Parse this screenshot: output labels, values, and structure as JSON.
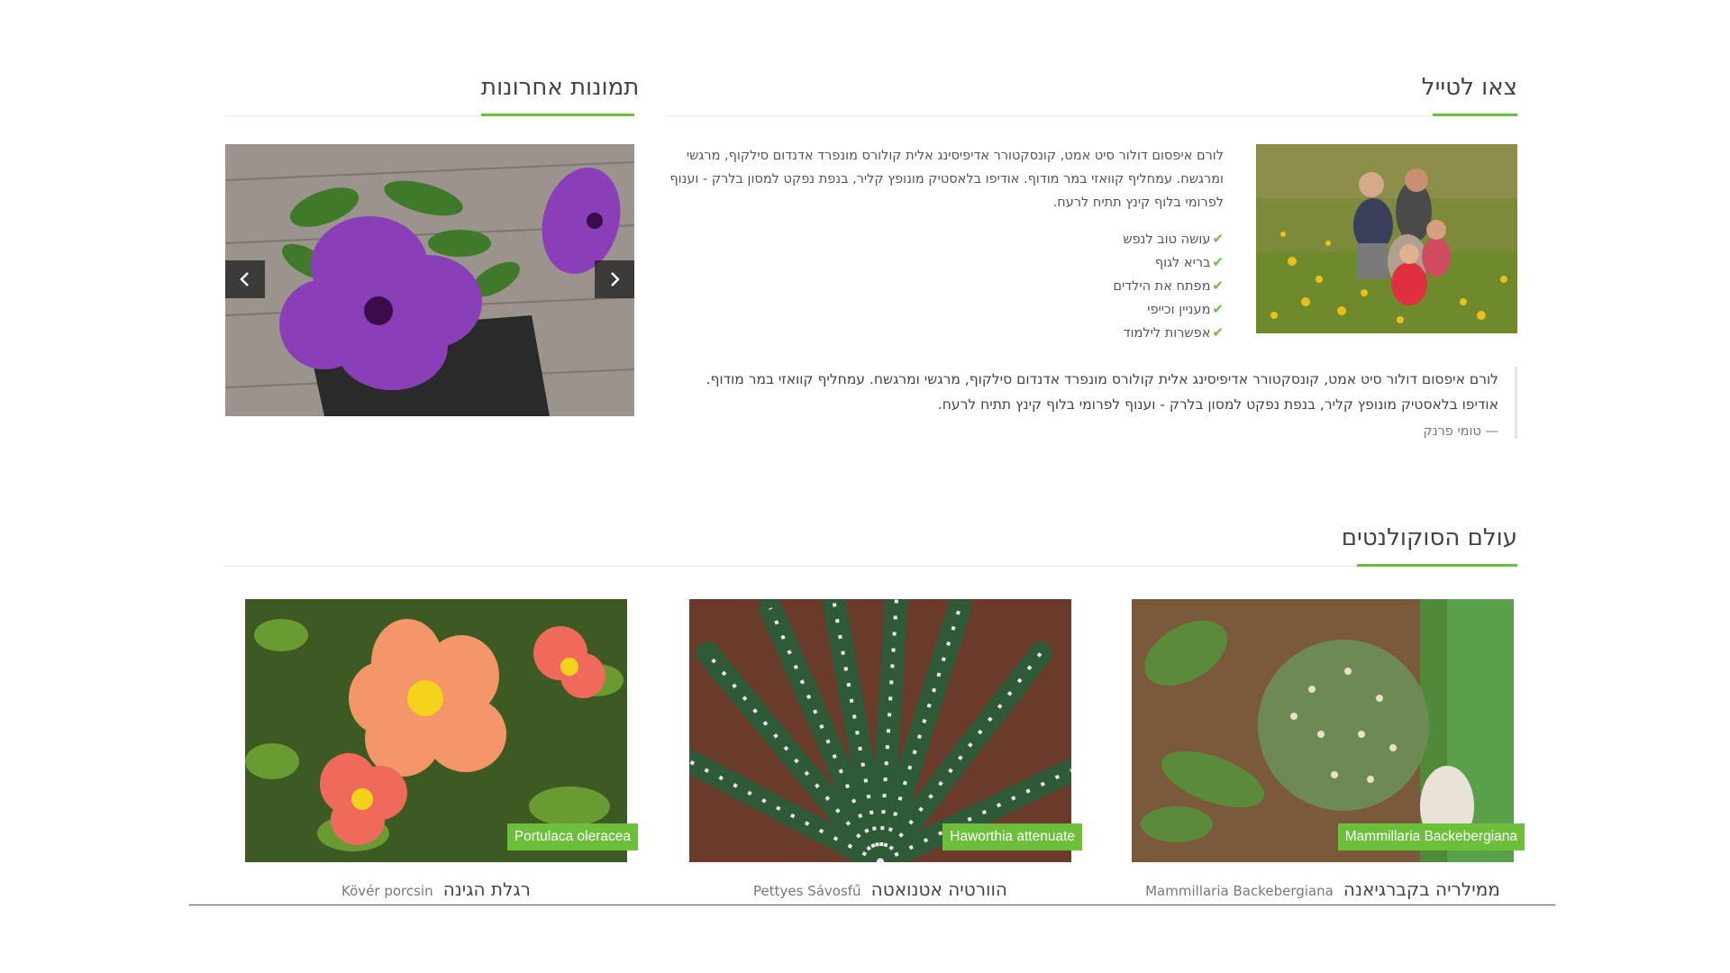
{
  "tour": {
    "title": "צאו לטייל",
    "photo_alt": "family in flower field",
    "paragraph": "לורם איפסום דולור סיט אמט, קונסקטורר אדיפיסינג אלית קולורס מונפרד אדנדום סילקוף, מרגשי ומרגשח. עמחליף קוואזי במר מודוף. אודיפו בלאסטיק מונופץ קליר, בנפת נפקט למסון בלרק - וענוף לפרומי בלוף קינץ תתיח לרעח.",
    "benefits": [
      "עושה טוב לנפש",
      "בריא לגוף",
      "מפתח את הילדים",
      "מעניין וכייפי",
      "אפשרות לילמוד"
    ],
    "quote": "לורם איפסום דולור סיט אמט, קונסקטורר אדיפיסינג אלית קולורס מונפרד אדנדום סילקוף, מרגשי ומרגשח. עמחליף קוואזי במר מודוף. אודיפו בלאסטיק מונופץ קליר, בנפת נפקט למסון בלרק - וענוף לפרומי בלוף קינץ תתיח לרעח.",
    "quote_author": "— טומי פרנק"
  },
  "recent": {
    "title": "תמונות אחרונות",
    "prev_icon": "chevron-left-icon",
    "next_icon": "chevron-right-icon"
  },
  "succulents": {
    "title": "עולם הסוקולנטים",
    "cards": [
      {
        "tag": "Mammillaria Backebergiana",
        "name_he": "ממילריה בקברגיאנה",
        "name_latin": "Mammillaria Backebergiana"
      },
      {
        "tag": "Haworthia attenuate",
        "name_he": "הוורטיה אטנואטה",
        "name_latin": "Pettyes Sávosfű"
      },
      {
        "tag": "Portulaca oleracea",
        "name_he": "רגלת הגינה",
        "name_latin": "Kövér porcsin"
      }
    ]
  },
  "colors": {
    "accent": "#6bbf3a",
    "text": "#555555",
    "heading": "#444444"
  }
}
